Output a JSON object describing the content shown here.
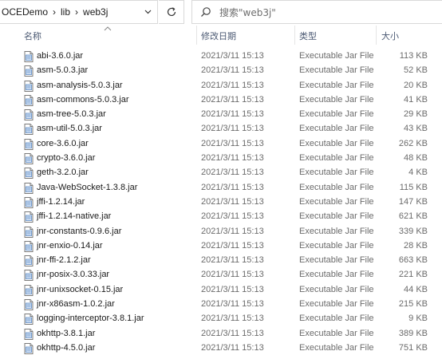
{
  "address": {
    "crumbs": [
      "OCEDemo",
      "lib",
      "web3j"
    ],
    "separator": "›"
  },
  "search": {
    "placeholder": "搜索\"web3j\""
  },
  "columns": {
    "name": "名称",
    "date": "修改日期",
    "type": "类型",
    "size": "大小"
  },
  "files": [
    {
      "name": "abi-3.6.0.jar",
      "date": "2021/3/11 15:13",
      "type": "Executable Jar File",
      "size": "113 KB"
    },
    {
      "name": "asm-5.0.3.jar",
      "date": "2021/3/11 15:13",
      "type": "Executable Jar File",
      "size": "52 KB"
    },
    {
      "name": "asm-analysis-5.0.3.jar",
      "date": "2021/3/11 15:13",
      "type": "Executable Jar File",
      "size": "20 KB"
    },
    {
      "name": "asm-commons-5.0.3.jar",
      "date": "2021/3/11 15:13",
      "type": "Executable Jar File",
      "size": "41 KB"
    },
    {
      "name": "asm-tree-5.0.3.jar",
      "date": "2021/3/11 15:13",
      "type": "Executable Jar File",
      "size": "29 KB"
    },
    {
      "name": "asm-util-5.0.3.jar",
      "date": "2021/3/11 15:13",
      "type": "Executable Jar File",
      "size": "43 KB"
    },
    {
      "name": "core-3.6.0.jar",
      "date": "2021/3/11 15:13",
      "type": "Executable Jar File",
      "size": "262 KB"
    },
    {
      "name": "crypto-3.6.0.jar",
      "date": "2021/3/11 15:13",
      "type": "Executable Jar File",
      "size": "48 KB"
    },
    {
      "name": "geth-3.2.0.jar",
      "date": "2021/3/11 15:13",
      "type": "Executable Jar File",
      "size": "4 KB"
    },
    {
      "name": "Java-WebSocket-1.3.8.jar",
      "date": "2021/3/11 15:13",
      "type": "Executable Jar File",
      "size": "115 KB"
    },
    {
      "name": "jffi-1.2.14.jar",
      "date": "2021/3/11 15:13",
      "type": "Executable Jar File",
      "size": "147 KB"
    },
    {
      "name": "jffi-1.2.14-native.jar",
      "date": "2021/3/11 15:13",
      "type": "Executable Jar File",
      "size": "621 KB"
    },
    {
      "name": "jnr-constants-0.9.6.jar",
      "date": "2021/3/11 15:13",
      "type": "Executable Jar File",
      "size": "339 KB"
    },
    {
      "name": "jnr-enxio-0.14.jar",
      "date": "2021/3/11 15:13",
      "type": "Executable Jar File",
      "size": "28 KB"
    },
    {
      "name": "jnr-ffi-2.1.2.jar",
      "date": "2021/3/11 15:13",
      "type": "Executable Jar File",
      "size": "663 KB"
    },
    {
      "name": "jnr-posix-3.0.33.jar",
      "date": "2021/3/11 15:13",
      "type": "Executable Jar File",
      "size": "221 KB"
    },
    {
      "name": "jnr-unixsocket-0.15.jar",
      "date": "2021/3/11 15:13",
      "type": "Executable Jar File",
      "size": "44 KB"
    },
    {
      "name": "jnr-x86asm-1.0.2.jar",
      "date": "2021/3/11 15:13",
      "type": "Executable Jar File",
      "size": "215 KB"
    },
    {
      "name": "logging-interceptor-3.8.1.jar",
      "date": "2021/3/11 15:13",
      "type": "Executable Jar File",
      "size": "9 KB"
    },
    {
      "name": "okhttp-3.8.1.jar",
      "date": "2021/3/11 15:13",
      "type": "Executable Jar File",
      "size": "389 KB"
    },
    {
      "name": "okhttp-4.5.0.jar",
      "date": "2021/3/11 15:13",
      "type": "Executable Jar File",
      "size": "751 KB"
    }
  ],
  "icons": {
    "file": "jar-file-icon",
    "search": "search-icon",
    "refresh": "refresh-icon",
    "dropdown": "chevron-down-icon",
    "sort": "sort-up-icon"
  }
}
